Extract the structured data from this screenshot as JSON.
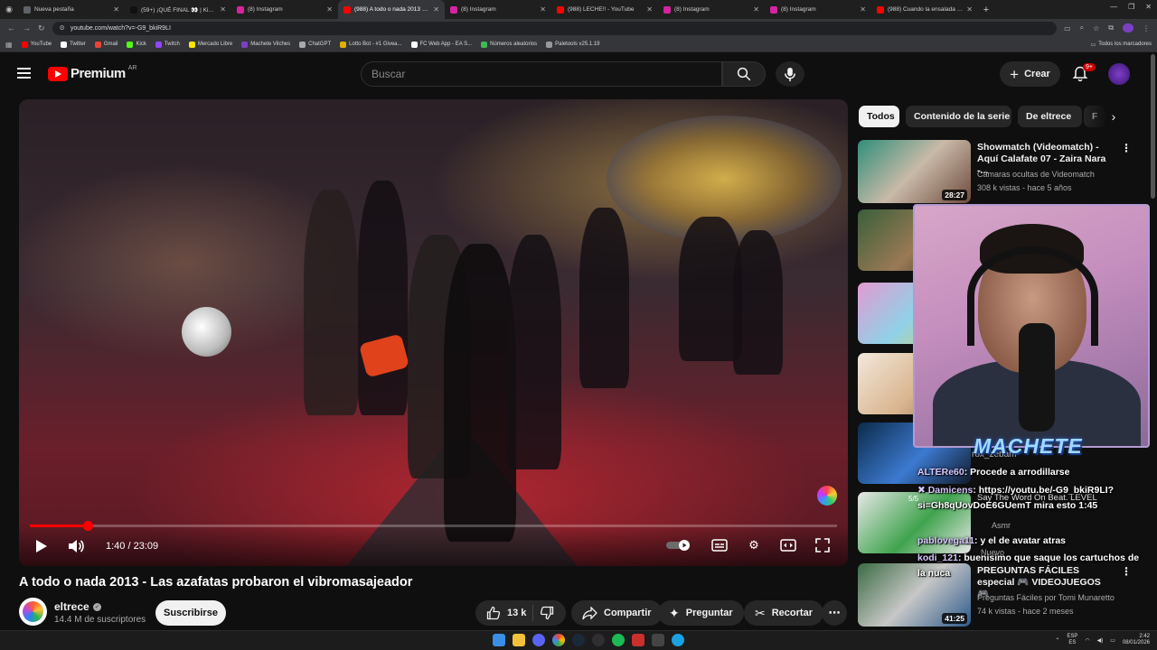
{
  "browser": {
    "tabs": [
      {
        "label": "Nueva pestaña",
        "color": "#5f6368"
      },
      {
        "label": "(59+) ¡QUÉ FINAL 👀 | Kingo Le...",
        "color": "#111111"
      },
      {
        "label": "(8) Instagram",
        "color": "#d6249f"
      },
      {
        "label": "(988) A todo o nada 2013 - La...",
        "color": "#ff0000",
        "active": true
      },
      {
        "label": "(8) Instagram",
        "color": "#d6249f"
      },
      {
        "label": "(988) LECHE!! - YouTube",
        "color": "#ff0000"
      },
      {
        "label": "(8) Instagram",
        "color": "#d6249f"
      },
      {
        "label": "(8) Instagram",
        "color": "#d6249f"
      },
      {
        "label": "(988) Cuando la ensalada se te...",
        "color": "#ff0000"
      }
    ],
    "url": "youtube.com/watch?v=-G9_bkiR9LI",
    "bookmarks": [
      {
        "label": "YouTube",
        "color": "#ff0000"
      },
      {
        "label": "Twitter",
        "color": "#ffffff"
      },
      {
        "label": "Gmail",
        "color": "#ea4335"
      },
      {
        "label": "Kick",
        "color": "#53fc18"
      },
      {
        "label": "Twitch",
        "color": "#9146ff"
      },
      {
        "label": "Mercado Libre",
        "color": "#ffe600"
      },
      {
        "label": "Machete Vilches",
        "color": "#7b3fc4"
      },
      {
        "label": "ChatGPT",
        "color": "#aaaaaa"
      },
      {
        "label": "Lotto Bot - #1 Givea...",
        "color": "#e0b000"
      },
      {
        "label": "FC Web App - EA S...",
        "color": "#ffffff"
      },
      {
        "label": "Números aleatorios",
        "color": "#3cba54"
      },
      {
        "label": "Paletools v25.1.19",
        "color": "#999999"
      }
    ],
    "bookmarks_all": "Todos los marcadores"
  },
  "youtube": {
    "logo_text": "Premium",
    "country_code": "AR",
    "search_placeholder": "Buscar",
    "create_label": "Crear",
    "notifications_badge": "9+"
  },
  "player": {
    "time": "1:40 / 23:09",
    "progress_fraction": 0.072
  },
  "video": {
    "title": "A todo o nada 2013 - Las azafatas probaron el vibromasajeador",
    "channel": "eltrece",
    "subscribers": "14.4 M de suscriptores",
    "subscribe_label": "Suscribirse",
    "likes": "13 k",
    "share_label": "Compartir",
    "ask_label": "Preguntar",
    "clip_label": "Recortar"
  },
  "chips": [
    "Todos",
    "Contenido de la serie",
    "De eltrece",
    "F"
  ],
  "recommended": [
    {
      "title": "Showmatch (Videomatch) - Aquí Calafate 07 - Zaira Nara -...",
      "channel": "Cámaras ocultas de Videomatch",
      "meta": "308 k vistas - hace 5 años",
      "duration": "28:27"
    },
    {
      "title": "PREGUNTAS FÁCILES especial 🎮 VIDEOJUEGOS 🎮",
      "channel": "Preguntas Fáciles por Tomi Munaretto",
      "meta": "74 k vistas - hace 2 meses",
      "duration": "41:25"
    }
  ],
  "stream": {
    "overlay_name": "MACHETE",
    "chat": [
      {
        "user": "ALTERe60",
        "text": ": Procede a arrodillarse"
      },
      {
        "user": "✖ Damicens",
        "text": ": https://youtu.be/-G9_bkiR9LI?"
      },
      {
        "user": "",
        "text": "si=Gh8qUovDoE6GUemT mira esto 1:45"
      },
      {
        "user": "pablovega11",
        "text": ": y el de avatar atras"
      },
      {
        "user": "kodi_121",
        "text": ": buenisimo que saque los cartuchos de"
      },
      {
        "user": "",
        "text": "la nuca"
      }
    ],
    "background_fragments": [
      "rox_zebam",
      "Say The Word On Beat. LEVEL",
      "5/5",
      "Asmr",
      "Nuevo"
    ]
  },
  "taskbar": {
    "lang_top": "ESP",
    "lang_bottom": "ES",
    "time": "2:42",
    "date": "08/01/2026"
  }
}
